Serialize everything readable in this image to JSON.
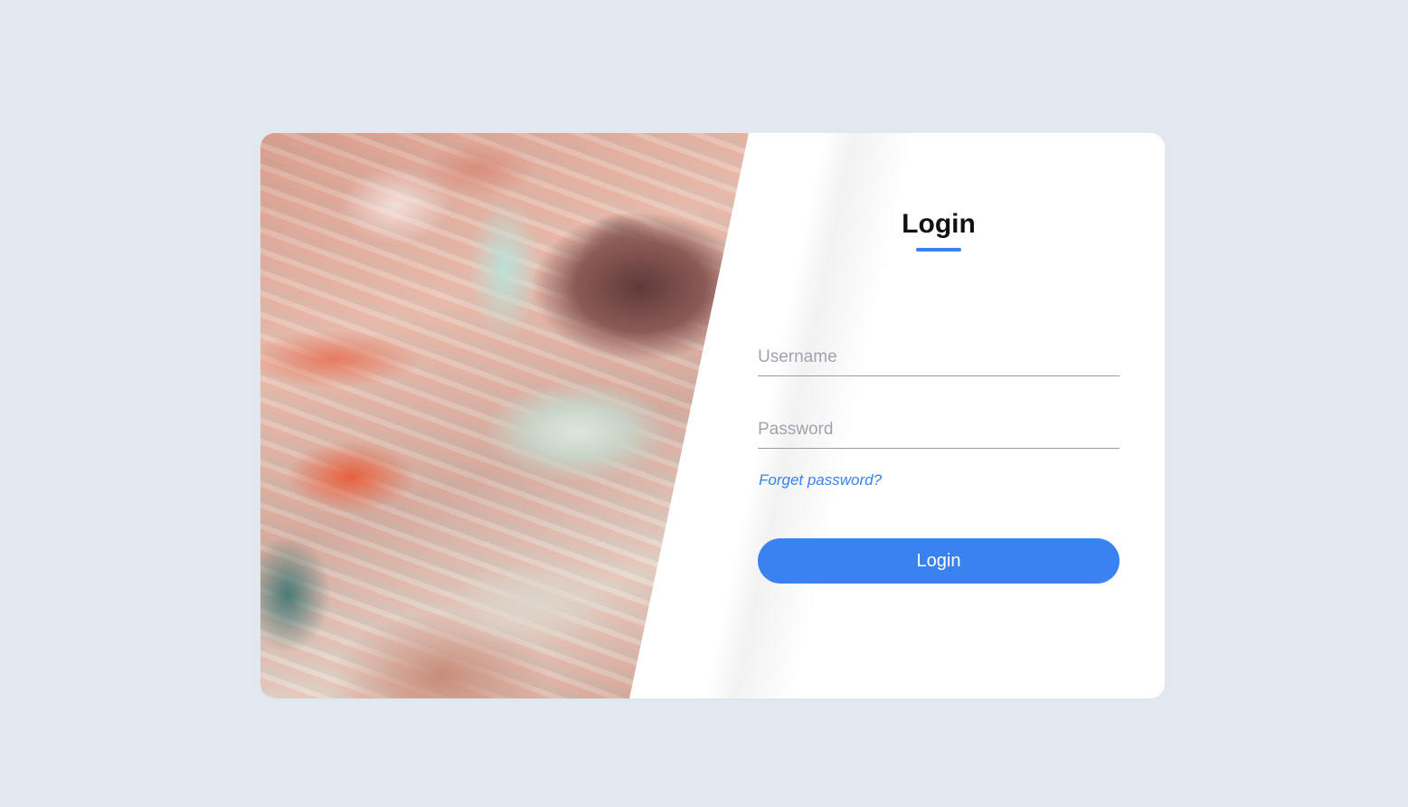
{
  "login": {
    "title": "Login",
    "username_placeholder": "Username",
    "password_placeholder": "Password",
    "forget_password": "Forget password?",
    "submit_label": "Login"
  },
  "colors": {
    "background": "#e1e8f0",
    "accent": "#3a82f0",
    "card": "#ffffff"
  }
}
